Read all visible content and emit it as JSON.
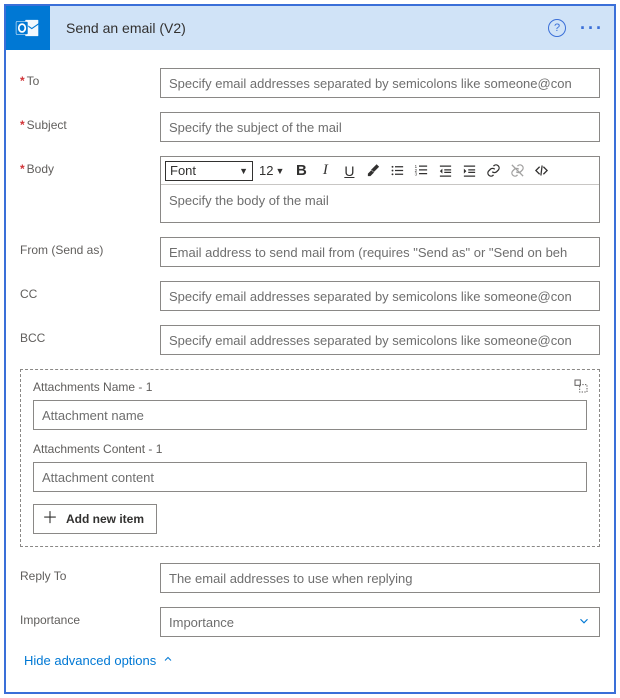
{
  "header": {
    "title": "Send an email (V2)"
  },
  "fields": {
    "to": {
      "label": "To",
      "placeholder": "Specify email addresses separated by semicolons like someone@con"
    },
    "subject": {
      "label": "Subject",
      "placeholder": "Specify the subject of the mail"
    },
    "body": {
      "label": "Body",
      "placeholder": "Specify the body of the mail"
    },
    "from": {
      "label": "From (Send as)",
      "placeholder": "Email address to send mail from (requires \"Send as\" or \"Send on beh"
    },
    "cc": {
      "label": "CC",
      "placeholder": "Specify email addresses separated by semicolons like someone@con"
    },
    "bcc": {
      "label": "BCC",
      "placeholder": "Specify email addresses separated by semicolons like someone@con"
    },
    "replyto": {
      "label": "Reply To",
      "placeholder": "The email addresses to use when replying"
    },
    "importance": {
      "label": "Importance",
      "placeholder": "Importance"
    }
  },
  "editor": {
    "font_label": "Font",
    "size_label": "12"
  },
  "attachments": {
    "name_label": "Attachments Name - 1",
    "name_ph": "Attachment name",
    "content_label": "Attachments Content - 1",
    "content_ph": "Attachment content",
    "add_label": "Add new item"
  },
  "footer": {
    "toggle_label": "Hide advanced options"
  }
}
